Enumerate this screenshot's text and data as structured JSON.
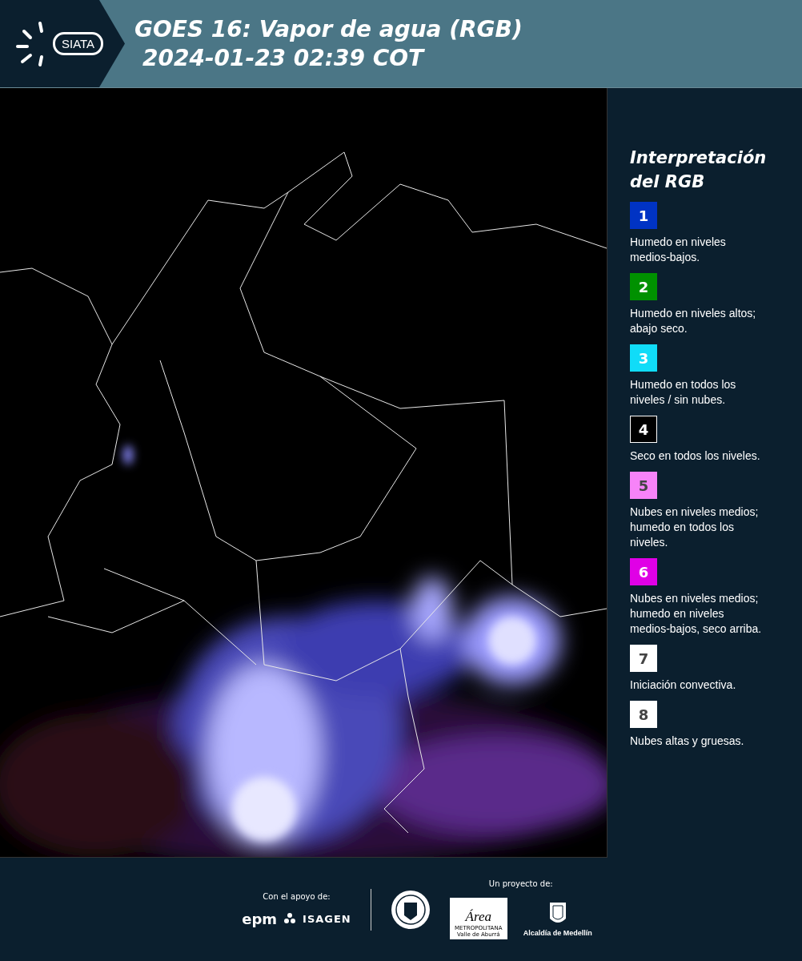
{
  "header": {
    "logo_text": "SIATA",
    "title_lines": [
      "GOES 16: Vapor de agua (RGB)",
      "2024-01-23 02:39 COT"
    ]
  },
  "legend": {
    "title": "Interpretación del RGB",
    "items": [
      {
        "number": "1",
        "color": "#0033c4",
        "description": "Humedo en niveles medios-bajos."
      },
      {
        "number": "2",
        "color": "#009100",
        "description": "Humedo en niveles altos; abajo seco."
      },
      {
        "number": "3",
        "color": "#10dcf8",
        "description": "Humedo en todos los niveles / sin nubes."
      },
      {
        "number": "4",
        "color": "#000000",
        "description": "Seco en todos los niveles."
      },
      {
        "number": "5",
        "color": "#f783f8",
        "description": "Nubes en niveles medios; humedo en todos los niveles."
      },
      {
        "number": "6",
        "color": "#e000e6",
        "description": "Nubes en niveles medios; humedo en niveles medios-bajos, seco arriba."
      },
      {
        "number": "7",
        "color": "#ffffff",
        "description": "Iniciación convectiva."
      },
      {
        "number": "8",
        "color": "#ffffff",
        "description": "Nubes altas y gruesas."
      }
    ]
  },
  "footer": {
    "support_label": "Con el apoyo de:",
    "support_logos": [
      "epm",
      "ISAGEN"
    ],
    "project_label": "Un proyecto de:",
    "area_logo": {
      "script": "Área",
      "lines": [
        "METROPOLITANA",
        "Valle de Aburrá"
      ]
    },
    "city_logo": "Alcaldía de Medellín"
  }
}
